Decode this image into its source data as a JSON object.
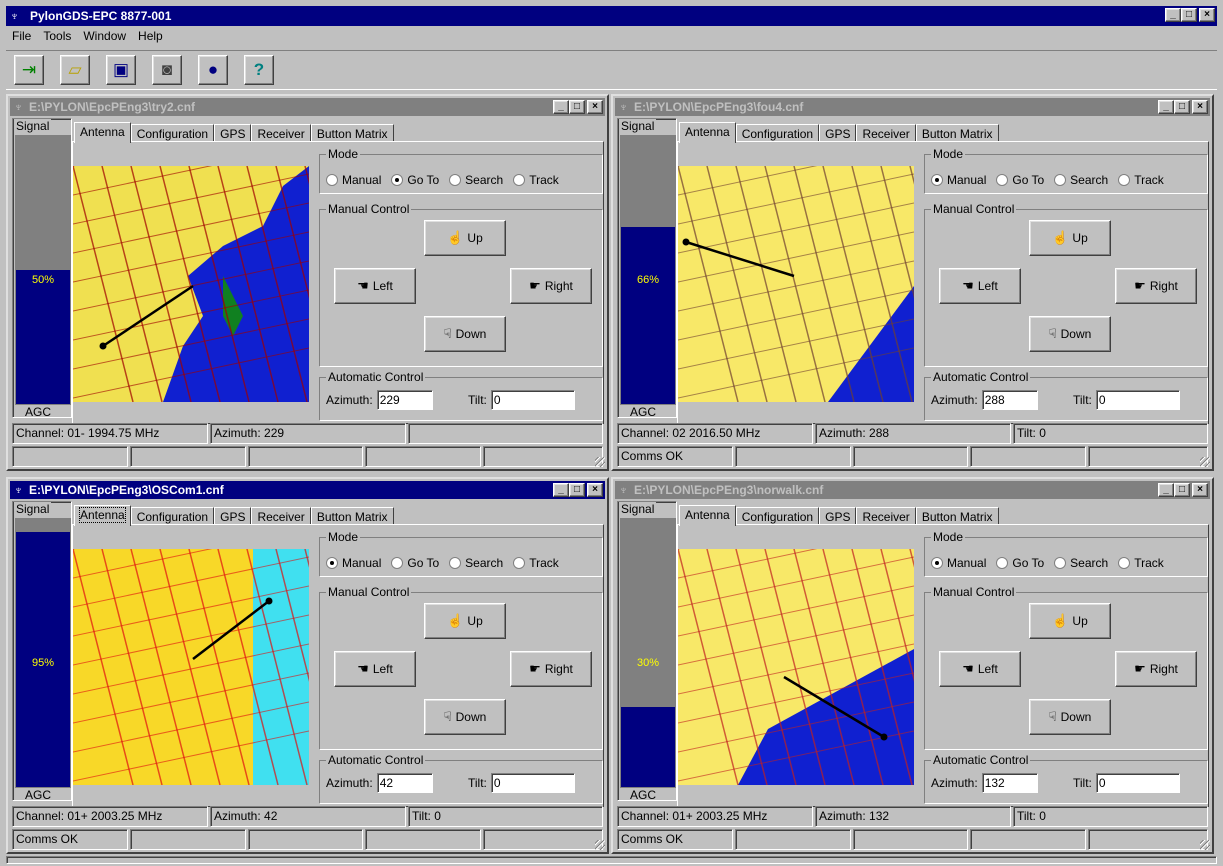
{
  "app": {
    "title": "PylonGDS-EPC 8877-001",
    "caption_buttons": [
      "_",
      "□",
      "×"
    ]
  },
  "menu": [
    "File",
    "Tools",
    "Window",
    "Help"
  ],
  "toolbar": [
    "exit-icon",
    "open-folder-icon",
    "save-icon",
    "camera-icon",
    "globe-icon",
    "help-icon"
  ],
  "labels": {
    "signal": "Signal",
    "agc": "AGC",
    "mode": "Mode",
    "manual_control": "Manual Control",
    "automatic_control": "Automatic Control",
    "azimuth": "Azimuth:",
    "tilt": "Tilt:",
    "up": "Up",
    "down": "Down",
    "left": "Left",
    "right": "Right"
  },
  "tabs": [
    "Antenna",
    "Configuration",
    "GPS",
    "Receiver",
    "Button Matrix"
  ],
  "modes": [
    "Manual",
    "Go To",
    "Search",
    "Track"
  ],
  "windows": [
    {
      "title": "E:\\PYLON\\EpcPEng3\\try2.cnf",
      "active": false,
      "signal_pct": "50%",
      "signal_level": 0.5,
      "mode": "Go To",
      "azimuth": "229",
      "tilt": "0",
      "status": [
        "Channel: 01- 1994.75 MHz",
        "Azimuth: 229",
        ""
      ],
      "comms": ""
    },
    {
      "title": "E:\\PYLON\\EpcPEng3\\fou4.cnf",
      "active": false,
      "signal_pct": "66%",
      "signal_level": 0.66,
      "mode": "Manual",
      "azimuth": "288",
      "tilt": "0",
      "status": [
        "Channel: 02  2016.50 MHz",
        "Azimuth: 288",
        "Tilt: 0"
      ],
      "comms": "Comms OK"
    },
    {
      "title": "E:\\PYLON\\EpcPEng3\\OSCom1.cnf",
      "active": true,
      "signal_pct": "95%",
      "signal_level": 0.95,
      "mode": "Manual",
      "azimuth": "42",
      "tilt": "0",
      "status": [
        "Channel: 01+ 2003.25 MHz",
        "Azimuth: 42",
        "Tilt: 0"
      ],
      "comms": "Comms OK"
    },
    {
      "title": "E:\\PYLON\\EpcPEng3\\norwalk.cnf",
      "active": false,
      "signal_pct": "30%",
      "signal_level": 0.3,
      "mode": "Manual",
      "azimuth": "132",
      "tilt": "0",
      "status": [
        "Channel: 01+ 2003.25 MHz",
        "Azimuth: 132",
        "Tilt: 0"
      ],
      "comms": "Comms OK"
    }
  ]
}
